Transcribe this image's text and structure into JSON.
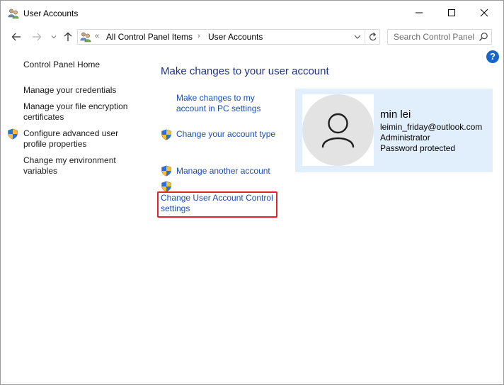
{
  "window": {
    "title": "User Accounts"
  },
  "nav": {
    "breadcrumb": [
      "All Control Panel Items",
      "User Accounts"
    ],
    "search_placeholder": "Search Control Panel"
  },
  "left_nav": {
    "home": "Control Panel Home",
    "credentials": "Manage your credentials",
    "encryption_l1": "Manage your file encryption",
    "encryption_l2": "certificates",
    "profile_l1": "Configure advanced user",
    "profile_l2": "profile properties",
    "env_l1": "Change my environment",
    "env_l2": "variables"
  },
  "main": {
    "heading": "Make changes to your user account",
    "pc_settings_l1": "Make changes to my",
    "pc_settings_l2": "account in PC settings",
    "account_type": "Change your account type",
    "another_account": "Manage another account",
    "uac_l1": "Change User Account Control",
    "uac_l2": "settings"
  },
  "account": {
    "name": "min lei",
    "email": "leimin_friday@outlook.com",
    "role": "Administrator",
    "status": "Password protected"
  },
  "colors": {
    "link": "#1a4fb4",
    "heading": "#1e3287",
    "panel_bg": "#e1eefb",
    "highlight": "#e4222a",
    "help": "#1a66c8"
  }
}
